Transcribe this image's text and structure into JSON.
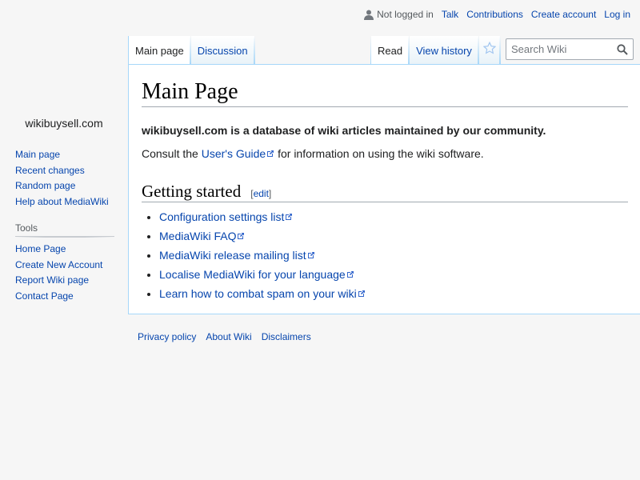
{
  "personal": {
    "not_logged_in": "Not logged in",
    "talk": "Talk",
    "contributions": "Contributions",
    "create_account": "Create account",
    "log_in": "Log in"
  },
  "site_name": "wikibuysell.com",
  "navigation": {
    "items": [
      "Main page",
      "Recent changes",
      "Random page",
      "Help about MediaWiki"
    ]
  },
  "tools": {
    "heading": "Tools",
    "items": [
      "Home Page",
      "Create New Account",
      "Report Wiki page",
      "Contact Page"
    ]
  },
  "tabs": {
    "main_page": "Main page",
    "discussion": "Discussion",
    "read": "Read",
    "view_history": "View history"
  },
  "search": {
    "placeholder": "Search Wiki"
  },
  "content": {
    "title": "Main Page",
    "intro": "wikibuysell.com is a database of wiki articles maintained by our community.",
    "consult_prefix": "Consult the ",
    "users_guide": "User's Guide",
    "consult_suffix": " for information on using the wiki software.",
    "section_title": "Getting started",
    "edit_open": "[",
    "edit_label": "edit",
    "edit_close": "]",
    "links": [
      "Configuration settings list",
      "MediaWiki FAQ",
      "MediaWiki release mailing list",
      "Localise MediaWiki for your language",
      "Learn how to combat spam on your wiki"
    ]
  },
  "footer": {
    "privacy": "Privacy policy",
    "about": "About Wiki",
    "disclaimers": "Disclaimers"
  },
  "colors": {
    "link": "#0645ad",
    "border": "#a7d7f9",
    "background": "#f6f6f6"
  }
}
